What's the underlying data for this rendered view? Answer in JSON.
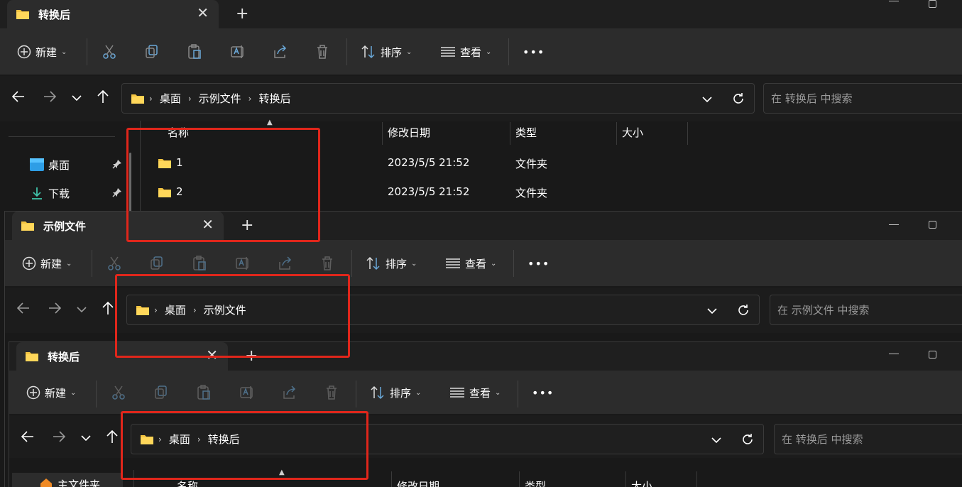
{
  "colors": {
    "accent_red": "#e0261b",
    "folder_yellow": "#f4c542",
    "bg": "#191919"
  },
  "window1": {
    "tab_title": "转换后",
    "new_label": "新建",
    "sort_label": "排序",
    "view_label": "查看",
    "more_label": "•••",
    "crumbs": [
      "桌面",
      "示例文件",
      "转换后"
    ],
    "search_placeholder": "在 转换后 中搜索",
    "sidebar": [
      {
        "label": "桌面",
        "icon": "desktop-icon"
      },
      {
        "label": "下载",
        "icon": "download-icon"
      }
    ],
    "columns": [
      "名称",
      "修改日期",
      "类型",
      "大小"
    ],
    "rows": [
      {
        "name": "1",
        "date": "2023/5/5 21:52",
        "type": "文件夹",
        "size": ""
      },
      {
        "name": "2",
        "date": "2023/5/5 21:52",
        "type": "文件夹",
        "size": ""
      }
    ]
  },
  "window2": {
    "tab_title": "示例文件",
    "new_label": "新建",
    "sort_label": "排序",
    "view_label": "查看",
    "more_label": "•••",
    "crumbs": [
      "桌面",
      "示例文件"
    ],
    "search_placeholder": "在 示例文件 中搜索"
  },
  "window3": {
    "tab_title": "转换后",
    "new_label": "新建",
    "sort_label": "排序",
    "view_label": "查看",
    "more_label": "•••",
    "crumbs": [
      "桌面",
      "转换后"
    ],
    "search_placeholder": "在 转换后 中搜索",
    "sidebar_partial": "主文件夹",
    "columns": [
      "名称",
      "修改日期",
      "类型",
      "大小"
    ]
  }
}
